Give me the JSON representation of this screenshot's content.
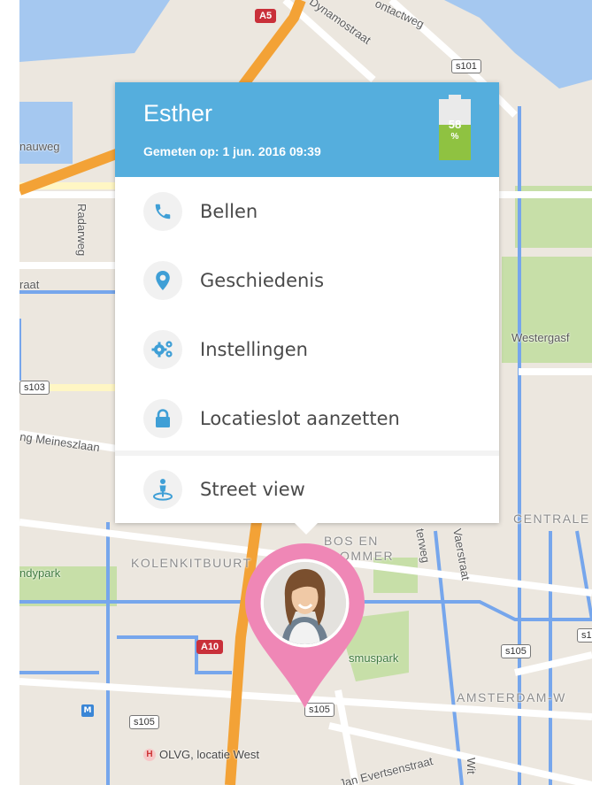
{
  "map": {
    "streets": [
      "nauweg",
      "Radarweg",
      "raat",
      "ng Meineszlaan",
      "Dynamostraat",
      "ontactweg",
      "Westergasf",
      "terweg",
      "Vaerstraat",
      "Jan Evertsenstraat",
      "Wit"
    ],
    "areas": [
      "KOLENKITBUURT",
      "BOS EN",
      "OMMER",
      "CENTRALE",
      "AMSTERDAM-W"
    ],
    "parks": [
      "ndypark",
      "smuspark"
    ],
    "road_shields": [
      "A5",
      "s101",
      "s103",
      "A10",
      "s105",
      "s105",
      "s105",
      "s105",
      "s10"
    ],
    "hospital": "OLVG, locatie West",
    "hospital_icon": "H",
    "metro_icon": "M",
    "colors": {
      "land": "#ece7df",
      "water": "#a5c8f0",
      "park": "#c7dfa8",
      "motorway": "#f3a236",
      "canal": "#76a6ec"
    }
  },
  "popup": {
    "name": "Esther",
    "measured_text": "Gemeten op: 1 jun. 2016 09:39",
    "battery": {
      "percent": 58,
      "label": "58",
      "sign": "%",
      "color": "#8fc241"
    },
    "header_color": "#55aedd",
    "menu": [
      {
        "label": "Bellen",
        "icon": "phone-icon"
      },
      {
        "label": "Geschiedenis",
        "icon": "location-pin-icon"
      },
      {
        "label": "Instellingen",
        "icon": "gears-icon"
      },
      {
        "label": "Locatieslot aanzetten",
        "icon": "lock-icon"
      },
      {
        "label": "Street view",
        "icon": "street-view-icon"
      }
    ]
  },
  "marker": {
    "color": "#ef87b6",
    "avatar": "avatar"
  }
}
